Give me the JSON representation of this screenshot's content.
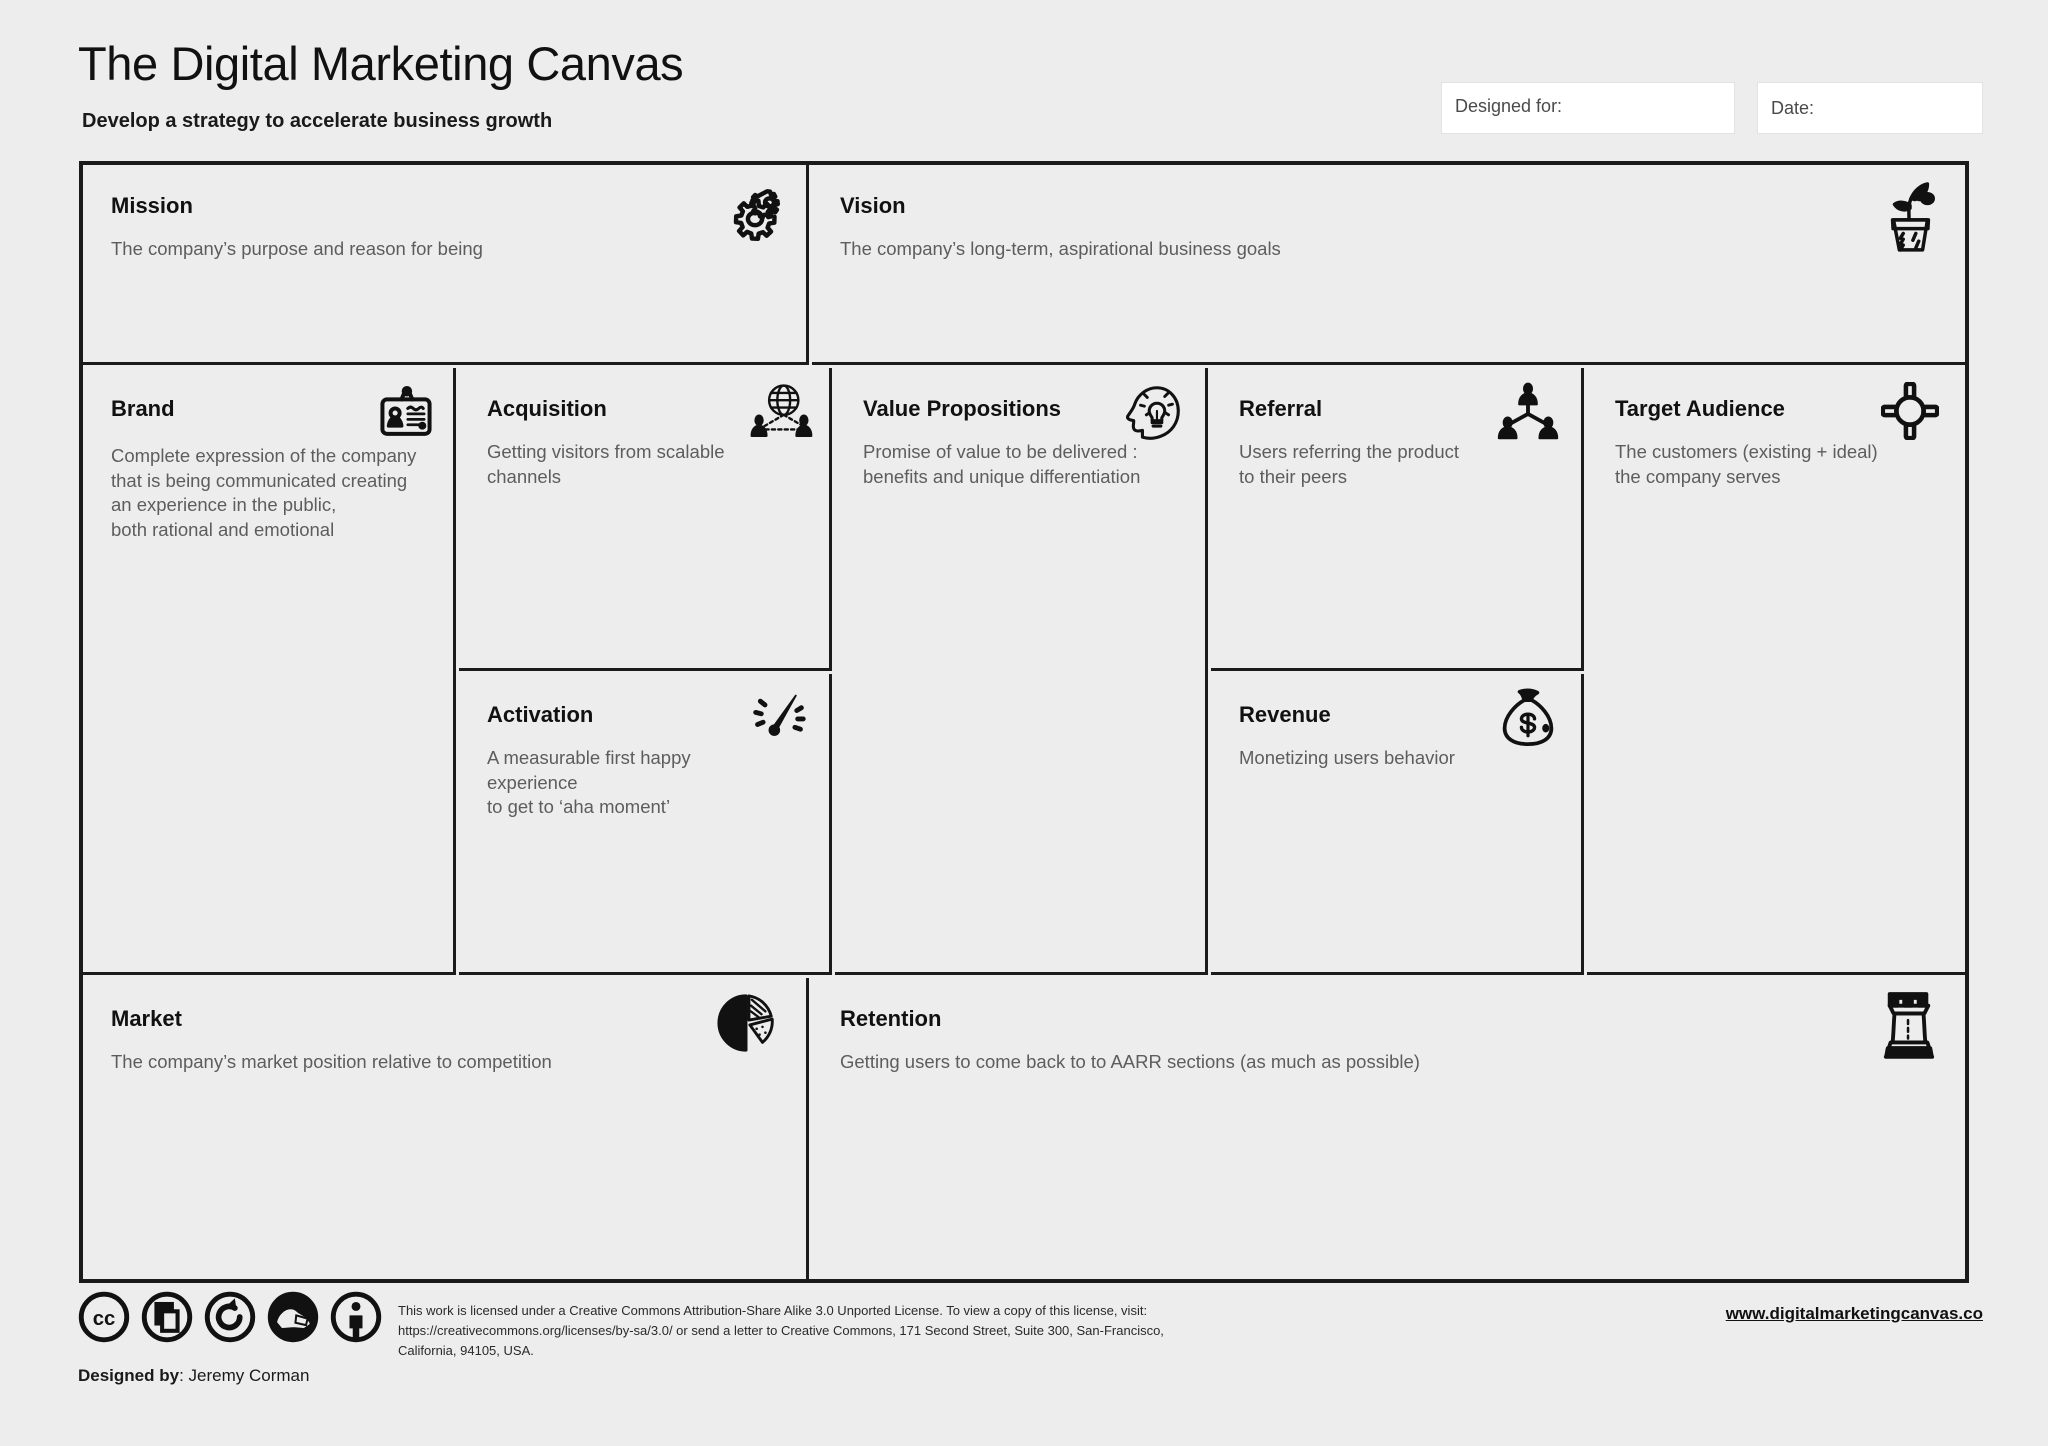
{
  "header": {
    "title": "The Digital Marketing Canvas",
    "subtitle": "Develop a strategy to accelerate business growth",
    "designed_for_label": "Designed for:",
    "designed_for_value": "",
    "date_label": "Date:",
    "date_value": ""
  },
  "blocks": {
    "mission": {
      "title": "Mission",
      "desc": "The company’s purpose and reason for being",
      "icon": "gears-icon"
    },
    "vision": {
      "title": "Vision",
      "desc": "The company’s long-term, aspirational business goals",
      "icon": "potted-plant-icon"
    },
    "brand": {
      "title": "Brand",
      "desc": "Complete expression of the company\nthat is being communicated creating\nan experience in the public,\nboth rational and emotional",
      "icon": "id-badge-icon"
    },
    "acquisition": {
      "title": "Acquisition",
      "desc": "Getting visitors from scalable\nchannels",
      "icon": "globe-network-icon"
    },
    "activation": {
      "title": "Activation",
      "desc": "A measurable first happy experience\nto get to ‘aha moment’",
      "icon": "speedometer-icon"
    },
    "value_props": {
      "title": "Value Propositions",
      "desc": "Promise of value to be delivered :\nbenefits and unique differentiation",
      "icon": "head-lightbulb-icon"
    },
    "referral": {
      "title": "Referral",
      "desc": "Users referring the product\nto their peers",
      "icon": "people-network-icon"
    },
    "revenue": {
      "title": "Revenue",
      "desc": "Monetizing users behavior",
      "icon": "money-bag-icon"
    },
    "target": {
      "title": "Target Audience",
      "desc": "The customers (existing + ideal)\nthe company serves",
      "icon": "crosshair-icon"
    },
    "market": {
      "title": "Market",
      "desc": "The company’s market position relative to competition",
      "icon": "pie-chart-icon"
    },
    "retention": {
      "title": "Retention",
      "desc": "Getting users to come back to to AARR sections (as much as possible)",
      "icon": "chess-rook-icon"
    }
  },
  "footer": {
    "license_line1": "This work is licensed under a Creative Commons Attribution-Share Alike 3.0 Unported License. To view a copy of this license, visit:",
    "license_line2": "https://creativecommons.org/licenses/by-sa/3.0/ or send a letter to Creative Commons, 171 Second Street, Suite 300, San-Francisco, California, 94105, USA.",
    "website": "www.digitalmarketingcanvas.co",
    "designed_by_label": "Designed by",
    "designed_by_name": ": Jeremy Corman",
    "cc_icons": [
      "cc-logo-icon",
      "cc-share-icon",
      "cc-sharealike-icon",
      "cc-remix-icon",
      "cc-attribution-icon"
    ]
  },
  "colors": {
    "background": "#ededed",
    "ink": "#1b1b1b",
    "body_text": "#5d5d5d",
    "field_bg": "#ffffff"
  }
}
